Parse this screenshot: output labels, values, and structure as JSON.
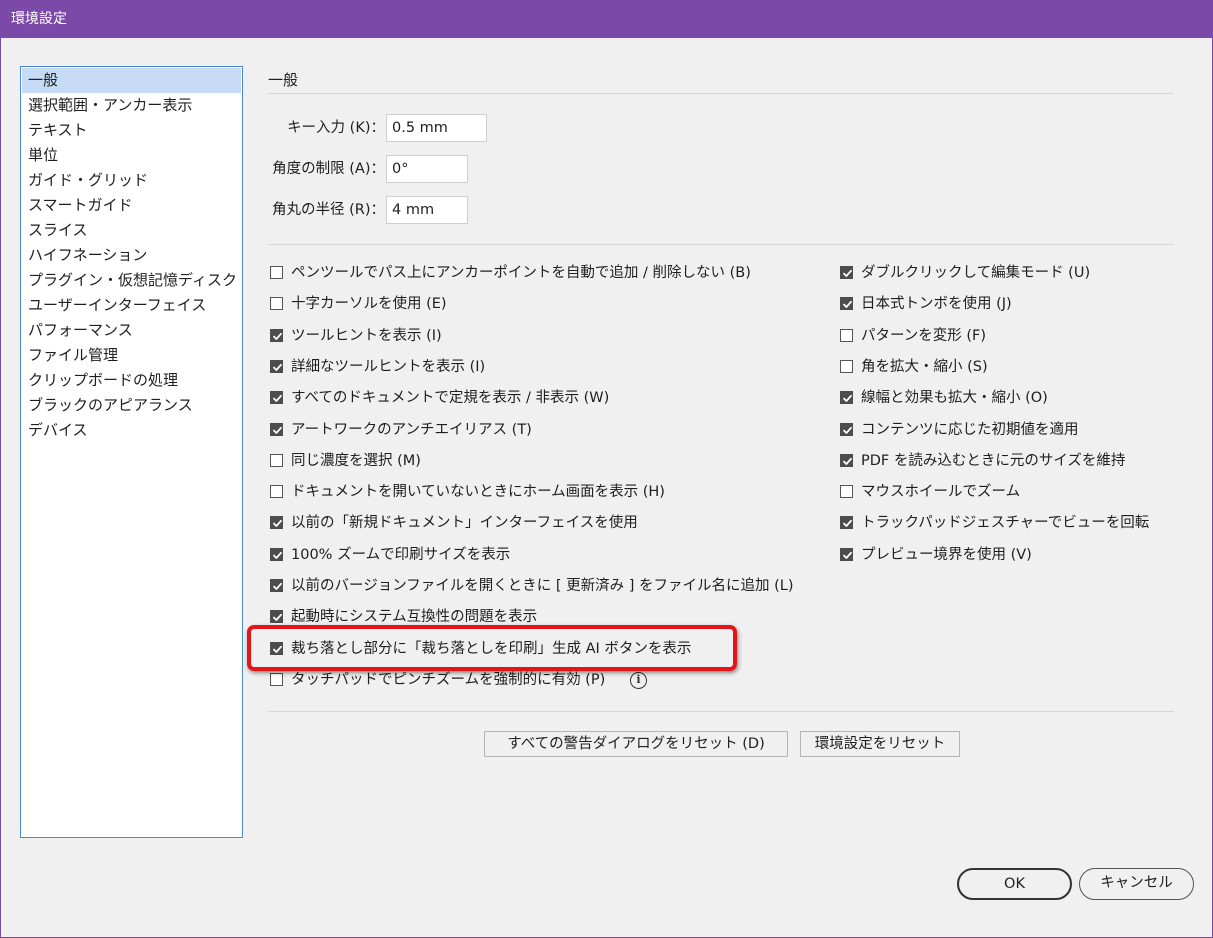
{
  "window": {
    "title": "環境設定"
  },
  "sidebar": {
    "items": [
      {
        "label": "一般",
        "selected": true
      },
      {
        "label": "選択範囲・アンカー表示"
      },
      {
        "label": "テキスト"
      },
      {
        "label": "単位"
      },
      {
        "label": "ガイド・グリッド"
      },
      {
        "label": "スマートガイド"
      },
      {
        "label": "スライス"
      },
      {
        "label": "ハイフネーション"
      },
      {
        "label": "プラグイン・仮想記憶ディスク"
      },
      {
        "label": "ユーザーインターフェイス"
      },
      {
        "label": "パフォーマンス"
      },
      {
        "label": "ファイル管理"
      },
      {
        "label": "クリップボードの処理"
      },
      {
        "label": "ブラックのアピアランス"
      },
      {
        "label": "デバイス"
      }
    ]
  },
  "main": {
    "section_title": "一般",
    "fields": {
      "key_input": {
        "label": "キー入力 (K)：",
        "value": "0.5 mm"
      },
      "angle": {
        "label": "角度の制限 (A)：",
        "value": "0°"
      },
      "corner_radius": {
        "label": "角丸の半径 (R)：",
        "value": "4 mm"
      }
    },
    "left_options": [
      {
        "label": "ペンツールでパス上にアンカーポイントを自動で追加 / 削除しない (B)",
        "checked": false
      },
      {
        "label": "十字カーソルを使用 (E)",
        "checked": false
      },
      {
        "label": "ツールヒントを表示 (I)",
        "checked": true
      },
      {
        "label": "詳細なツールヒントを表示 (I)",
        "checked": true
      },
      {
        "label": "すべてのドキュメントで定規を表示 / 非表示 (W)",
        "checked": true
      },
      {
        "label": "アートワークのアンチエイリアス (T)",
        "checked": true
      },
      {
        "label": "同じ濃度を選択 (M)",
        "checked": false
      },
      {
        "label": "ドキュメントを開いていないときにホーム画面を表示 (H)",
        "checked": false
      },
      {
        "label": "以前の「新規ドキュメント」インターフェイスを使用",
        "checked": true
      },
      {
        "label": "100% ズームで印刷サイズを表示",
        "checked": true
      },
      {
        "label": "以前のバージョンファイルを開くときに [ 更新済み ] をファイル名に追加 (L)",
        "checked": true
      },
      {
        "label": "起動時にシステム互換性の問題を表示",
        "checked": true
      },
      {
        "label": "裁ち落とし部分に「裁ち落としを印刷」生成 AI ボタンを表示",
        "checked": true
      },
      {
        "label": "タッチパッドでピンチズームを強制的に有効 (P)",
        "checked": false
      }
    ],
    "right_options": [
      {
        "label": "ダブルクリックして編集モード (U)",
        "checked": true
      },
      {
        "label": "日本式トンボを使用 (J)",
        "checked": true
      },
      {
        "label": "パターンを変形 (F)",
        "checked": false
      },
      {
        "label": "角を拡大・縮小 (S)",
        "checked": false
      },
      {
        "label": "線幅と効果も拡大・縮小 (O)",
        "checked": true
      },
      {
        "label": "コンテンツに応じた初期値を適用",
        "checked": true
      },
      {
        "label": "PDF を読み込むときに元のサイズを維持",
        "checked": true
      },
      {
        "label": "マウスホイールでズーム",
        "checked": false
      },
      {
        "label": "トラックパッドジェスチャーでビューを回転",
        "checked": true
      },
      {
        "label": "プレビュー境界を使用 (V)",
        "checked": true
      }
    ],
    "info_glyph": "i",
    "reset_warnings_label": "すべての警告ダイアログをリセット (D)",
    "reset_prefs_label": "環境設定をリセット"
  },
  "footer": {
    "ok_label": "OK",
    "cancel_label": "キャンセル"
  },
  "colors": {
    "titlebar": "#7b4aa8",
    "selection": "#c6dcf6",
    "highlight": "#e4141b"
  },
  "icons": {
    "checkbox_checked": "checkmark-icon",
    "info": "info-icon"
  }
}
